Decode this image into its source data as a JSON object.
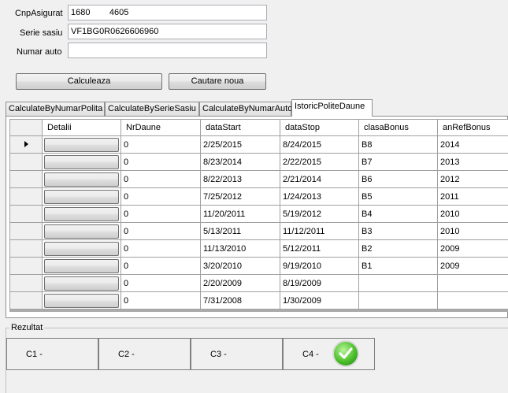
{
  "form": {
    "cnp_label": "CnpAsigurat",
    "cnp_value": "1680        4605",
    "serie_label": "Serie sasiu",
    "serie_value": "VF1BG0R0626606960",
    "numar_label": "Numar auto",
    "numar_value": ""
  },
  "buttons": {
    "calculeaza": "Calculeaza",
    "cautare_noua": "Cautare noua"
  },
  "tabs": [
    {
      "label": "CalculateByNumarPolita"
    },
    {
      "label": "CalculateBySerieSasiu"
    },
    {
      "label": "CalculateByNumarAuto"
    },
    {
      "label": "IstoricPoliteDaune"
    }
  ],
  "grid": {
    "columns": [
      "Detalii",
      "NrDaune",
      "dataStart",
      "dataStop",
      "clasaBonus",
      "anRefBonus"
    ],
    "rows": [
      {
        "nrDaune": "0",
        "dataStart": "2/25/2015",
        "dataStop": "8/24/2015",
        "clasaBonus": "B8",
        "anRefBonus": "2014"
      },
      {
        "nrDaune": "0",
        "dataStart": "8/23/2014",
        "dataStop": "2/22/2015",
        "clasaBonus": "B7",
        "anRefBonus": "2013"
      },
      {
        "nrDaune": "0",
        "dataStart": "8/22/2013",
        "dataStop": "2/21/2014",
        "clasaBonus": "B6",
        "anRefBonus": "2012"
      },
      {
        "nrDaune": "0",
        "dataStart": "7/25/2012",
        "dataStop": "1/24/2013",
        "clasaBonus": "B5",
        "anRefBonus": "2011"
      },
      {
        "nrDaune": "0",
        "dataStart": "11/20/2011",
        "dataStop": "5/19/2012",
        "clasaBonus": "B4",
        "anRefBonus": "2010"
      },
      {
        "nrDaune": "0",
        "dataStart": "5/13/2011",
        "dataStop": "11/12/2011",
        "clasaBonus": "B3",
        "anRefBonus": "2010"
      },
      {
        "nrDaune": "0",
        "dataStart": "11/13/2010",
        "dataStop": "5/12/2011",
        "clasaBonus": "B2",
        "anRefBonus": "2009"
      },
      {
        "nrDaune": "0",
        "dataStart": "3/20/2010",
        "dataStop": "9/19/2010",
        "clasaBonus": "B1",
        "anRefBonus": "2009"
      },
      {
        "nrDaune": "0",
        "dataStart": "2/20/2009",
        "dataStop": "8/19/2009",
        "clasaBonus": "",
        "anRefBonus": ""
      },
      {
        "nrDaune": "0",
        "dataStart": "7/31/2008",
        "dataStop": "1/30/2009",
        "clasaBonus": "",
        "anRefBonus": ""
      }
    ]
  },
  "rezultat": {
    "title": "Rezultat",
    "c1": "C1 -",
    "c2": "C2 -",
    "c3": "C3 -",
    "c4": "C4 -",
    "status_icon": "green-checkmark-icon"
  }
}
